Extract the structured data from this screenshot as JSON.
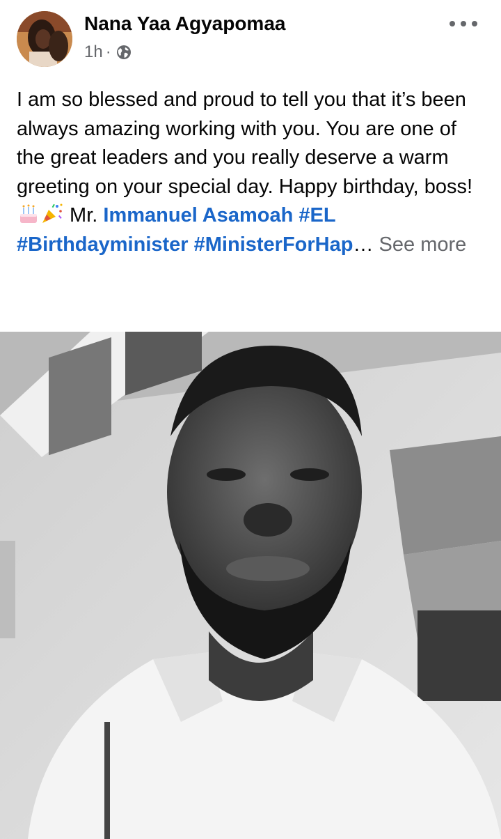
{
  "post": {
    "author_name": "Nana Yaa Agyapomaa",
    "time": "1h",
    "separator": "·",
    "privacy_icon": "globe-icon",
    "menu_icon": "more-horizontal-icon",
    "text": {
      "line1": "I am so blessed and proud to tell you that it’s been always amazing working with you. You are one of the great leaders and you really deserve a warm greeting on your special day. Happy birthday, boss!",
      "emoji_cake": "birthday-cake-emoji",
      "emoji_party": "party-popper-emoji",
      "mr": " Mr. ",
      "mention": "Immanuel Asamoah",
      "hashtag1": "#EL",
      "hashtag2": "#Birthdayminister",
      "hashtag3": "#MinisterForHap",
      "ellipsis": "…",
      "see_more": "See more"
    },
    "photo_alt": "Black and white selfie of a bearded man in a white shirt"
  },
  "colors": {
    "link": "#1a66c9",
    "secondary_text": "#65676b",
    "primary_text": "#050505"
  }
}
